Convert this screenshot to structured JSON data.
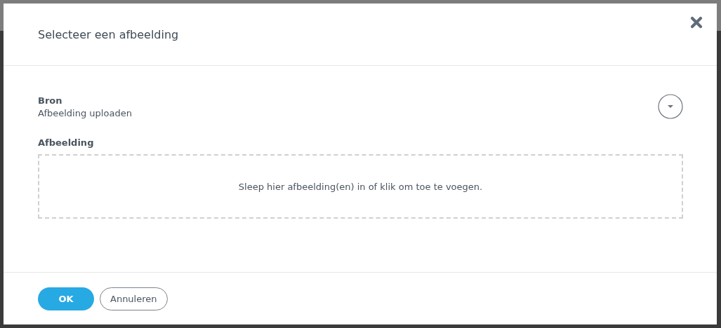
{
  "dialog": {
    "title": "Selecteer een afbeelding"
  },
  "fields": [
    {
      "kind": "select",
      "label": "Bron",
      "value": "Afbeelding uploaden"
    },
    {
      "kind": "dropzone",
      "label": "Afbeelding",
      "hint": "Sleep hier afbeelding(en) in of klik om toe te voegen."
    }
  ],
  "buttons": [
    {
      "label": "OK",
      "kind": "primary"
    },
    {
      "label": "Annuleren",
      "kind": "secondary"
    }
  ]
}
